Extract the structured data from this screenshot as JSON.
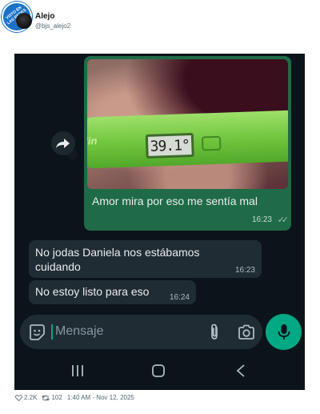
{
  "watermark": {
    "text": "VISTO EN LAS REDES .COM"
  },
  "tweet": {
    "author_name": "Alejo",
    "author_handle": "@bjs_alejo2",
    "likes": "2.2K",
    "retweets": "102",
    "timestamp": "1:40 AM - Nov 12, 2025"
  },
  "chat": {
    "thermometer": {
      "brand": "klin",
      "reading": "39.1°"
    },
    "messages": [
      {
        "direction": "outgoing",
        "text": "Amor mira por eso me sentía mal",
        "time": "16:23",
        "status": "read"
      },
      {
        "direction": "incoming",
        "text": "No jodas Daniela nos estábamos cuidando",
        "time": "16:23"
      },
      {
        "direction": "incoming",
        "text": "No estoy listo para eso",
        "time": "16:24"
      }
    ],
    "composer": {
      "placeholder": "Mensaje"
    }
  },
  "icons": {
    "forward": "forward-icon",
    "emoji": "sticker-icon",
    "attach": "paperclip-icon",
    "camera": "camera-icon",
    "mic": "microphone-icon"
  },
  "colors": {
    "chat_background": "#0b141a",
    "outgoing_bubble": "#1f6b47",
    "incoming_bubble": "#202c33",
    "accent": "#00a884"
  }
}
